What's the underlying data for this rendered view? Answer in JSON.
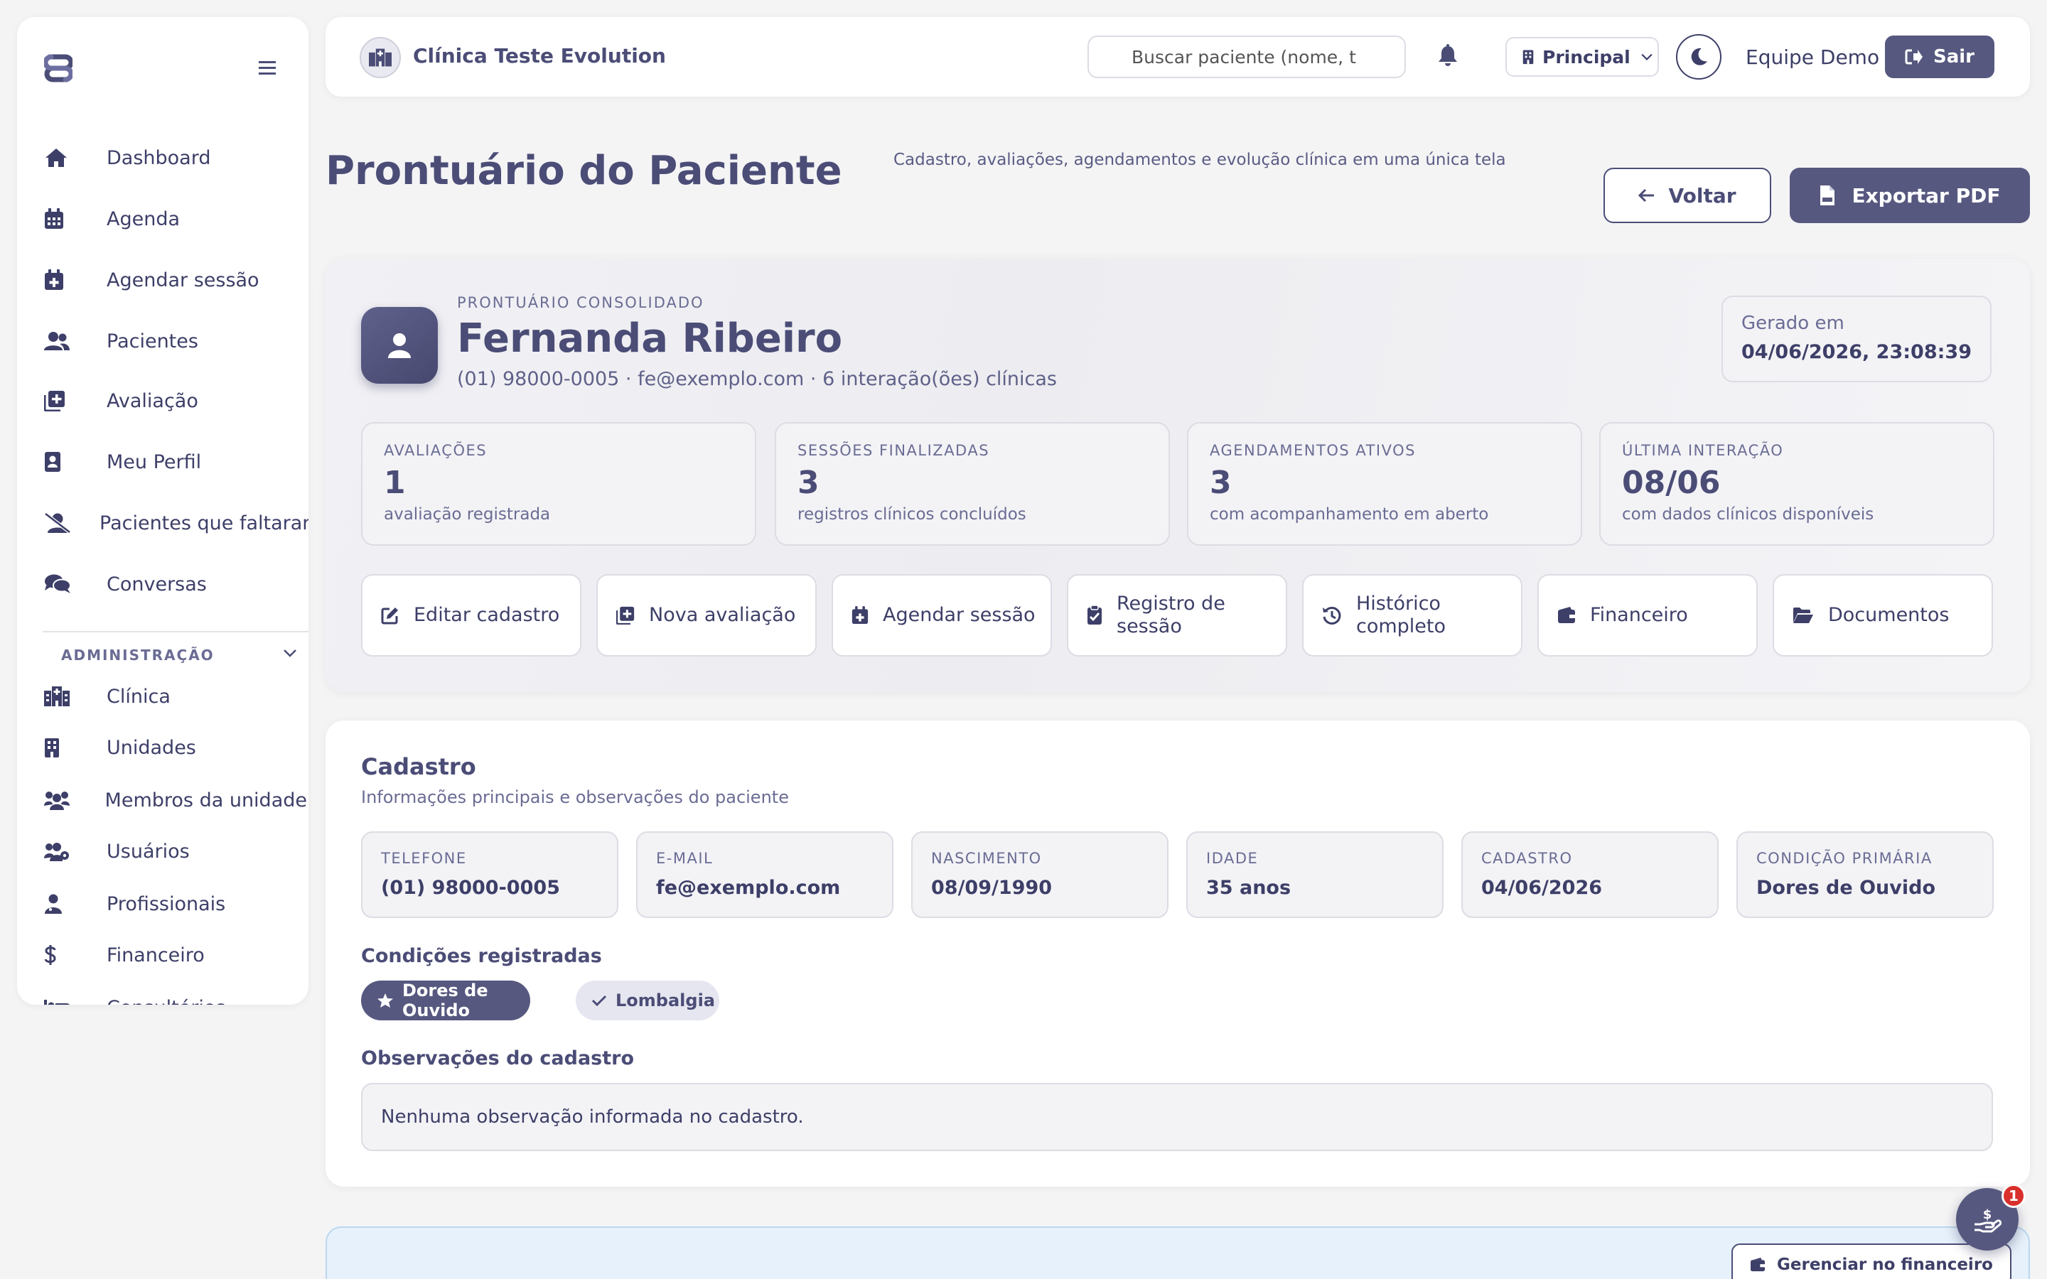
{
  "sidebar": {
    "items": [
      {
        "label": "Dashboard",
        "icon": "home-icon"
      },
      {
        "label": "Agenda",
        "icon": "calendar-icon"
      },
      {
        "label": "Agendar sessão",
        "icon": "calendar-plus-icon"
      },
      {
        "label": "Pacientes",
        "icon": "users-icon"
      },
      {
        "label": "Avaliação",
        "icon": "clipboard-plus-icon"
      },
      {
        "label": "Meu Perfil",
        "icon": "id-badge-icon"
      },
      {
        "label": "Pacientes que faltaram",
        "icon": "user-slash-icon"
      },
      {
        "label": "Conversas",
        "icon": "chat-icon"
      }
    ],
    "admin_title": "ADMINISTRAÇÃO",
    "admin_items": [
      {
        "label": "Clínica",
        "icon": "hospital-icon"
      },
      {
        "label": "Unidades",
        "icon": "building-icon"
      },
      {
        "label": "Membros da unidade",
        "icon": "people-group-icon"
      },
      {
        "label": "Usuários",
        "icon": "users-cog-icon"
      },
      {
        "label": "Profissionais",
        "icon": "user-doctor-icon"
      },
      {
        "label": "Financeiro",
        "icon": "dollar-icon"
      },
      {
        "label": "Consultórios",
        "icon": "bed-icon"
      }
    ]
  },
  "topbar": {
    "clinic_name": "Clínica Teste Evolution",
    "search_placeholder": "Buscar paciente (nome, t",
    "unit": "Principal",
    "user": "Equipe Demo",
    "logout": "Sair"
  },
  "page": {
    "title": "Prontuário do Paciente",
    "subtitle": "Cadastro, avaliações, agendamentos e evolução clínica em uma única tela",
    "back": "Voltar",
    "export": "Exportar PDF"
  },
  "patient": {
    "eyebrow": "PRONTUÁRIO CONSOLIDADO",
    "name": "Fernanda Ribeiro",
    "meta": "(01) 98000-0005 · fe@exemplo.com · 6 interação(ões) clínicas",
    "generated_label": "Gerado em",
    "generated_value": "04/06/2026, 23:08:39"
  },
  "stats": [
    {
      "label": "AVALIAÇÕES",
      "value": "1",
      "desc": "avaliação registrada"
    },
    {
      "label": "SESSÕES FINALIZADAS",
      "value": "3",
      "desc": "registros clínicos concluídos"
    },
    {
      "label": "AGENDAMENTOS ATIVOS",
      "value": "3",
      "desc": "com acompanhamento em aberto"
    },
    {
      "label": "ÚLTIMA INTERAÇÃO",
      "value": "08/06",
      "desc": "com dados clínicos disponíveis"
    }
  ],
  "actions": [
    {
      "label": "Editar cadastro"
    },
    {
      "label": "Nova avaliação"
    },
    {
      "label": "Agendar sessão"
    },
    {
      "label": "Registro de sessão"
    },
    {
      "label": "Histórico completo"
    },
    {
      "label": "Financeiro"
    },
    {
      "label": "Documentos"
    }
  ],
  "cadastro": {
    "title": "Cadastro",
    "subtitle": "Informações principais e observações do paciente",
    "fields": [
      {
        "label": "TELEFONE",
        "value": "(01) 98000-0005"
      },
      {
        "label": "E-MAIL",
        "value": "fe@exemplo.com"
      },
      {
        "label": "NASCIMENTO",
        "value": "08/09/1990"
      },
      {
        "label": "IDADE",
        "value": "35 anos"
      },
      {
        "label": "CADASTRO",
        "value": "04/06/2026"
      },
      {
        "label": "CONDIÇÃO PRIMÁRIA",
        "value": "Dores de Ouvido"
      }
    ],
    "conditions_title": "Condições registradas",
    "conditions": [
      {
        "label": "Dores de Ouvido",
        "primary": true
      },
      {
        "label": "Lombalgia",
        "primary": false
      }
    ],
    "obs_title": "Observações do cadastro",
    "obs_text": "Nenhuma observação informada no cadastro."
  },
  "finance": {
    "button": "Gerenciar no financeiro"
  },
  "fab": {
    "badge": "1"
  },
  "colors": {
    "accent": "#56587f",
    "text": "#4b4d77",
    "badge": "#d9302c"
  }
}
